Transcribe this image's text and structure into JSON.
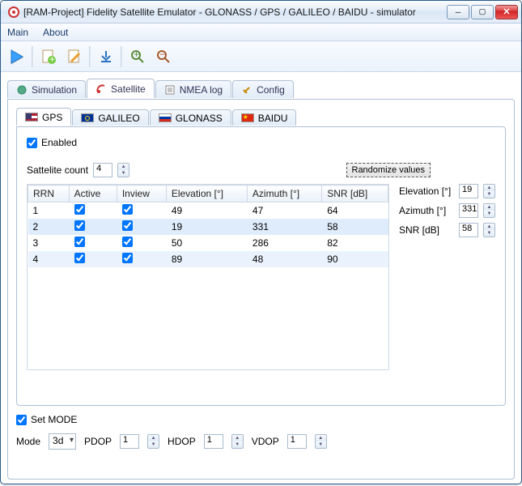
{
  "window": {
    "title": "[RAM-Project] Fidelity Satellite Emulator - GLONASS / GPS / GALILEO / BAIDU - simulator"
  },
  "menu": {
    "main": "Main",
    "about": "About"
  },
  "tabs": {
    "simulation": "Simulation",
    "satellite": "Satellite",
    "nmea": "NMEA log",
    "config": "Config"
  },
  "subtabs": {
    "gps": "GPS",
    "galileo": "GALILEO",
    "glonass": "GLONASS",
    "baidu": "BAIDU"
  },
  "gps": {
    "enabled_label": "Enabled",
    "sat_count_label": "Sattelite count",
    "sat_count": "4",
    "randomize": "Randomize values",
    "headers": {
      "rrn": "RRN",
      "active": "Active",
      "inview": "Inview",
      "elev": "Elevation [°]",
      "az": "Azimuth [°]",
      "snr": "SNR [dB]"
    },
    "rows": [
      {
        "rrn": "1",
        "active": true,
        "inview": true,
        "elev": "49",
        "az": "47",
        "snr": "64"
      },
      {
        "rrn": "2",
        "active": true,
        "inview": true,
        "elev": "19",
        "az": "331",
        "snr": "58"
      },
      {
        "rrn": "3",
        "active": true,
        "inview": true,
        "elev": "50",
        "az": "286",
        "snr": "82"
      },
      {
        "rrn": "4",
        "active": true,
        "inview": true,
        "elev": "89",
        "az": "48",
        "snr": "90"
      }
    ],
    "side": {
      "elev_label": "Elevation [°]",
      "elev": "19",
      "az_label": "Azimuth [°]",
      "az": "331",
      "snr_label": "SNR [dB]",
      "snr": "58"
    }
  },
  "mode_section": {
    "set_mode": "Set MODE",
    "mode_label": "Mode",
    "mode_value": "3d",
    "pdop_label": "PDOP",
    "pdop": "1",
    "hdop_label": "HDOP",
    "hdop": "1",
    "vdop_label": "VDOP",
    "vdop": "1"
  }
}
